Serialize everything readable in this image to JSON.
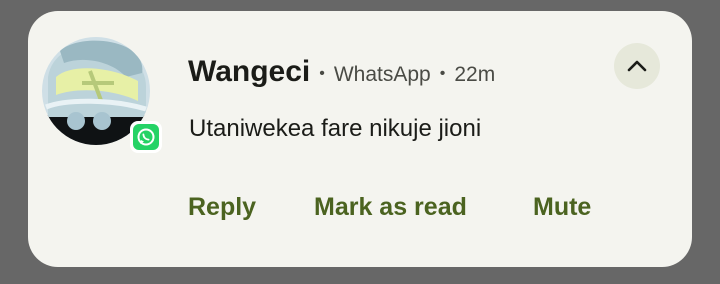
{
  "notification": {
    "sender": "Wangeci",
    "app_name": "WhatsApp",
    "time_ago": "22m",
    "separator": "•",
    "message": "Utaniwekea fare nikuje jioni",
    "avatar_icon": "contact-photo",
    "app_icon": "whatsapp-icon",
    "expand_icon": "chevron-up-icon",
    "actions": [
      {
        "label": "Reply"
      },
      {
        "label": "Mark as read"
      },
      {
        "label": "Mute"
      }
    ]
  },
  "colors": {
    "background": "#676767",
    "card": "#f4f4ef",
    "action_text": "#4b6320",
    "expand_button": "#e6e8da",
    "whatsapp_green": "#25d366"
  }
}
